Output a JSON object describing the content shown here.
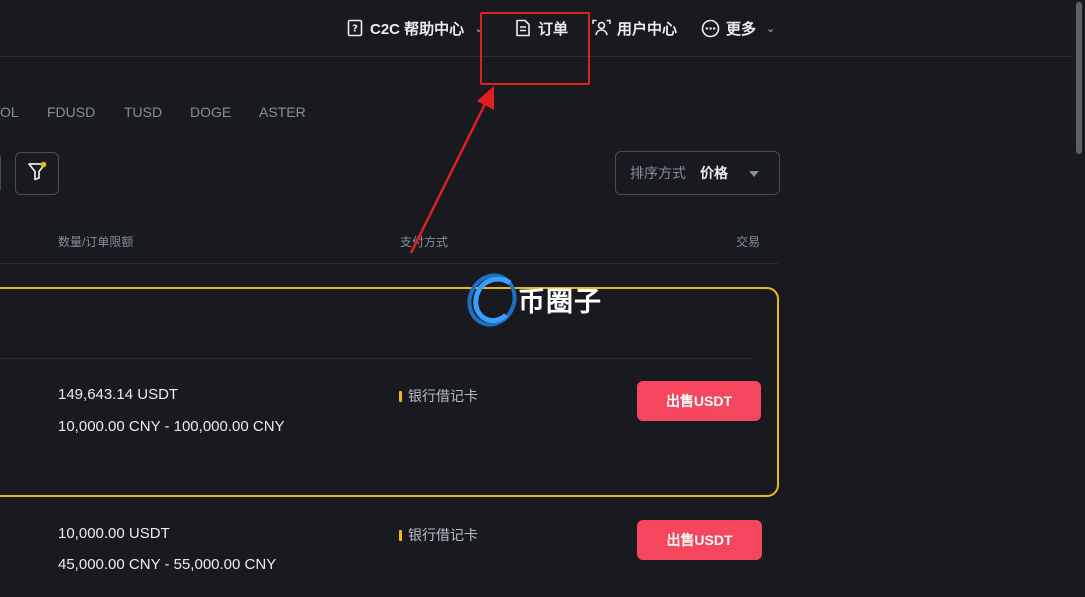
{
  "header": {
    "nav": [
      {
        "label": "C2C 帮助中心",
        "icon": "help-doc-icon",
        "has_dropdown": true
      },
      {
        "label": "订单",
        "icon": "document-icon",
        "has_dropdown": false
      },
      {
        "label": "用户中心",
        "icon": "user-center-icon",
        "has_dropdown": false
      },
      {
        "label": "更多",
        "icon": "more-icon",
        "has_dropdown": true
      }
    ]
  },
  "coin_tabs": [
    "OL",
    "FDUSD",
    "TUSD",
    "DOGE",
    "ASTER"
  ],
  "filters": {
    "sort_label": "排序方式",
    "sort_value": "价格"
  },
  "table": {
    "headers": {
      "amount": "数量/订单限额",
      "payment": "支付方式",
      "trade": "交易"
    },
    "rows": [
      {
        "quantity": "149,643.14 USDT",
        "limit": "10,000.00 CNY - 100,000.00 CNY",
        "payment": "银行借记卡",
        "action": "出售USDT"
      },
      {
        "quantity": "10,000.00 USDT",
        "limit": "45,000.00 CNY - 55,000.00 CNY",
        "payment": "银行借记卡",
        "action": "出售USDT"
      }
    ]
  },
  "watermark": {
    "text": "币圈子"
  },
  "colors": {
    "background": "#181a20",
    "sell": "#f6465d",
    "highlight": "#f0b90b",
    "annotation": "#e02020"
  }
}
